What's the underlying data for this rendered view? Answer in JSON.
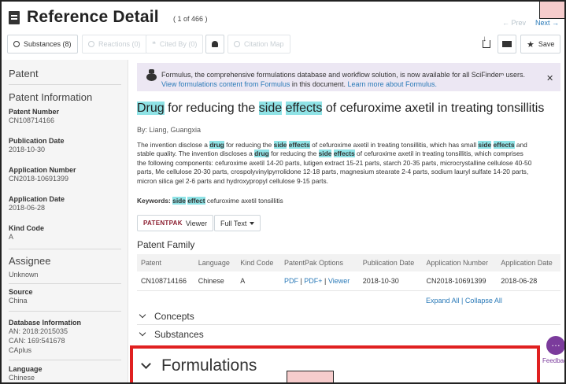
{
  "header": {
    "title": "Reference Detail",
    "record_count": "( 1 of 466 )",
    "prev": "← Prev",
    "next": "Next →"
  },
  "toolbar": {
    "substances": "Substances (8)",
    "reactions": "Reactions (0)",
    "cited_by": "Cited By (0)",
    "citation_map": "Citation Map",
    "save": "Save"
  },
  "sidebar": {
    "section1": "Patent",
    "section2": "Patent Information",
    "fields": [
      {
        "label": "Patent Number",
        "value": "CN108714166"
      },
      {
        "label": "Publication Date",
        "value": "2018-10-30"
      },
      {
        "label": "Application Number",
        "value": "CN2018-10691399"
      },
      {
        "label": "Application Date",
        "value": "2018-06-28"
      },
      {
        "label": "Kind Code",
        "value": "A"
      }
    ],
    "section3": "Assignee",
    "assignee": "Unknown",
    "source_label": "Source",
    "source_value": "China",
    "db_label": "Database Information",
    "db_lines": [
      "AN: 2018:2015035",
      "CAN: 169:541678",
      "CAplus"
    ],
    "lang_label": "Language",
    "lang_value": "Chinese"
  },
  "notice": {
    "line1": "Formulus, the comprehensive formulations database and workflow solution, is now available for all SciFinderⁿ users.",
    "line2_link": "View formulations content from Formulus",
    "line2_mid": " in this document. ",
    "line2_link2": "Learn more about Formulus."
  },
  "document": {
    "title_parts": [
      "Drug",
      " for reducing the ",
      "side",
      " ",
      "effects",
      " of cefuroxime axetil in treating tonsillitis"
    ],
    "byline": "By: Liang, Guangxia",
    "abstract_lines": [
      [
        "The invention disclose a ",
        "drug",
        " for reducing the ",
        "side",
        " ",
        "effects",
        " of cefuroxime axetil in treating tonsillitis, which has small ",
        "side",
        " ",
        "effects",
        " and"
      ],
      [
        "stable quality. The invention discloses a ",
        "drug",
        " for reducing the ",
        "side",
        " ",
        "effects",
        " of cefuroxime axetil in treating tonsillitis, which comprises"
      ],
      [
        "the following components: cefuroxime axetil 14-20 parts, lutigen extract 15-21 parts, starch 20-35 parts, microcrystalline cellulose 40-50"
      ],
      [
        "parts, Me cellulose 20-30 parts, crospolyvinylpyrrolidone 12-18 parts, magnesium stearate 2-4 parts, sodium lauryl sulfate 14-20 parts,"
      ],
      [
        "micron silica gel 2-6 parts and hydroxypropyl cellulose 9-15 parts."
      ]
    ],
    "keywords_label": "Keywords: ",
    "keywords_hl": [
      "side",
      "effect"
    ],
    "keywords_rest": " cefuroxime axetil tonsillitis",
    "patentpak_brand": "PATENTPAK",
    "patentpak_viewer": "Viewer",
    "full_text": "Full Text"
  },
  "patent_family": {
    "title": "Patent Family",
    "headers": [
      "Patent",
      "Language",
      "Kind Code",
      "PatentPak Options",
      "Publication Date",
      "Application Number",
      "Application Date"
    ],
    "row": {
      "patent": "CN108714166",
      "language": "Chinese",
      "kind": "A",
      "pdf": "PDF",
      "pdf_plus": "PDF+",
      "viewer": "Viewer",
      "pub_date": "2018-10-30",
      "app_number": "CN2018-10691399",
      "app_date": "2018-06-28"
    },
    "expand_all": "Expand All",
    "collapse_all": "Collapse All"
  },
  "sections": {
    "concepts": "Concepts",
    "substances": "Substances",
    "formulations": "Formulations"
  },
  "feedback": "Feedback",
  "colors": {
    "highlight": "#8fe3e6",
    "link": "#2a7ab8",
    "notice_bg": "#ece7f3",
    "focus_border": "#e02020",
    "feedback": "#7b3b9c"
  }
}
